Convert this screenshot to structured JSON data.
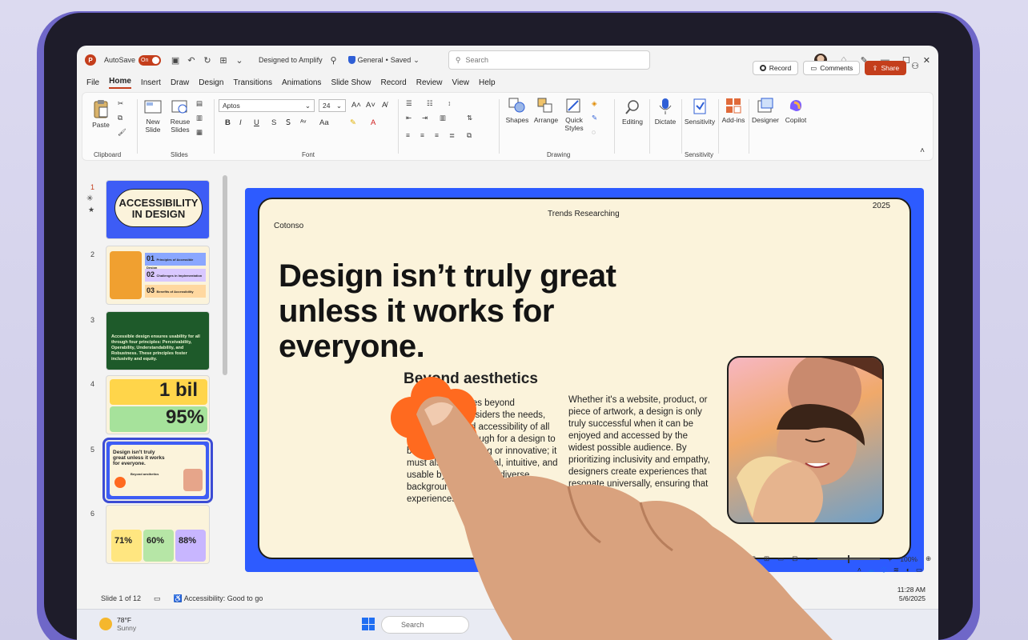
{
  "app": {
    "autosave_label": "AutoSave",
    "autosave_state": "On",
    "doc_title": "Designed to Amplify",
    "sensitivity": "General",
    "save_state": "Saved",
    "search_placeholder": "Search"
  },
  "actions": {
    "record": "Record",
    "comments": "Comments",
    "share": "Share"
  },
  "tabs": [
    "File",
    "Home",
    "Insert",
    "Draw",
    "Design",
    "Transitions",
    "Animations",
    "Slide Show",
    "Record",
    "Review",
    "View",
    "Help"
  ],
  "ribbon": {
    "paste": "Paste",
    "clipboard": "Clipboard",
    "new_slide_1": "New",
    "new_slide_2": "Slide",
    "reuse_slides_1": "Reuse",
    "reuse_slides_2": "Slides",
    "slides": "Slides",
    "font_name": "Aptos",
    "font_size": "24",
    "font": "Font",
    "shapes": "Shapes",
    "arrange": "Arrange",
    "quick_styles_1": "Quick",
    "quick_styles_2": "Styles",
    "drawing": "Drawing",
    "editing": "Editing",
    "dictate": "Dictate",
    "sensitivity": "Sensitivity",
    "sensitivity_group": "Sensitivity",
    "add_ins": "Add-ins",
    "designer": "Designer",
    "copilot": "Copilot",
    "fmt": {
      "bold": "B",
      "italic": "I",
      "underline": "U",
      "strike": "S"
    }
  },
  "thumbnails": [
    {
      "num": "1",
      "title_1": "ACCESSIBILITY",
      "title_2": "IN DESIGN"
    },
    {
      "num": "2",
      "items": [
        {
          "n": "01",
          "label": "Principles of Accessible Design"
        },
        {
          "n": "02",
          "label": "Challenges in Implementation"
        },
        {
          "n": "03",
          "label": "Benefits of Accessibility"
        }
      ]
    },
    {
      "num": "3",
      "text": "Accessible design ensures usability for all through four principles: Perceivability, Operability, Understandability, and Robustness. These principles foster inclusivity and equity."
    },
    {
      "num": "4",
      "stat_1": "1 bil",
      "stat_2": "95%"
    },
    {
      "num": "5",
      "title": "Design isn't truly great unless it works for everyone.",
      "sub": "Beyond aesthetics"
    },
    {
      "num": "6",
      "stats": [
        "71%",
        "60%",
        "88%"
      ]
    }
  ],
  "slide": {
    "brand": "Cotonso",
    "center": "Trends Researching",
    "year": "2025",
    "headline": "Design isn’t truly great unless it works for everyone.",
    "subheading": "Beyond aesthetics",
    "col1": "Great design goes beyond aesthetics; it considers the needs, preferences, and accessibility of all users. It's not enough for a design to be visually appealing or innovative; it must also be functional, intuitive, and usable by people from diverse backgrounds, abilities, and experiences.",
    "col2": "Whether it's a website, product, or piece of artwork, a design is only truly successful when it can be enjoyed and accessed by the widest possible audience. By prioritizing inclusivity and empathy, designers create experiences that resonate universally, ensuring that no one"
  },
  "status": {
    "slide_count": "Slide 1 of 12",
    "accessibility": "Accessibility: Good to go",
    "zoom": "100%"
  },
  "taskbar": {
    "temp": "78°F",
    "condition": "Sunny",
    "search": "Search",
    "time": "11:28 AM",
    "date": "5/6/2025"
  },
  "colors": {
    "accent": "#c43e1c",
    "slide_border": "#2d5bff",
    "slide_bg": "#fbf3db",
    "flower": "#ff6a1f"
  }
}
